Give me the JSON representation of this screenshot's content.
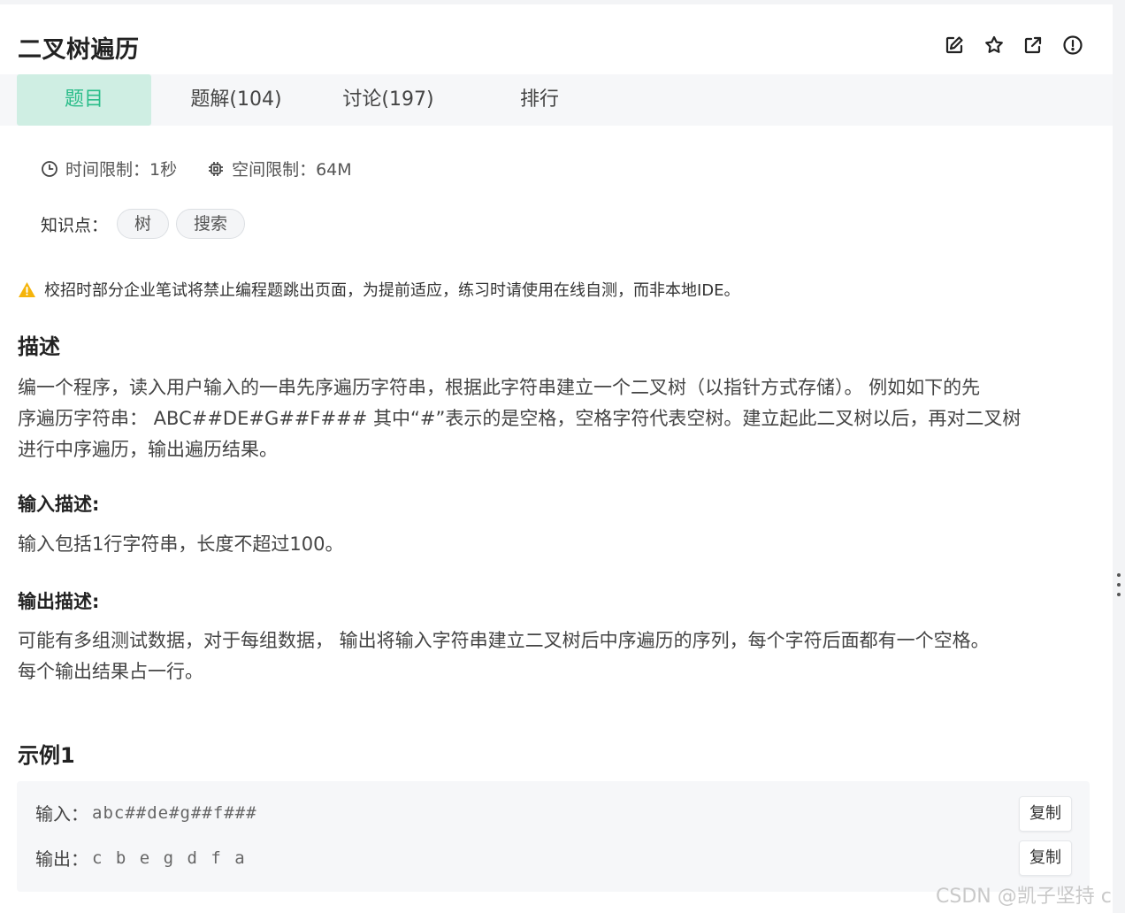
{
  "problem": {
    "title": "二叉树遍历"
  },
  "tabs": [
    {
      "label": "题目"
    },
    {
      "label": "题解(104)"
    },
    {
      "label": "讨论(197)"
    },
    {
      "label": "排行"
    }
  ],
  "limits": {
    "time": "时间限制：1秒",
    "space": "空间限制：64M"
  },
  "knowledge": {
    "label": "知识点：",
    "tags": [
      "树",
      "搜索"
    ]
  },
  "notice": "校招时部分企业笔试将禁止编程题跳出页面，为提前适应，练习时请使用在线自测，而非本地IDE。",
  "description": {
    "heading": "描述",
    "line1": "编一个程序，读入用户输入的一串先序遍历字符串，根据此字符串建立一个二叉树（以指针方式存储）。 例如如下的先",
    "line2": "序遍历字符串： ABC##DE#G##F### 其中“#”表示的是空格，空格字符代表空树。建立起此二叉树以后，再对二叉树",
    "line3": "进行中序遍历，输出遍历结果。"
  },
  "input_desc": {
    "heading": "输入描述:",
    "text": "输入包括1行字符串，长度不超过100。"
  },
  "output_desc": {
    "heading": "输出描述:",
    "line1": "可能有多组测试数据，对于每组数据， 输出将输入字符串建立二叉树后中序遍历的序列，每个字符后面都有一个空格。",
    "line2": "每个输出结果占一行。"
  },
  "example": {
    "heading": "示例1",
    "input_label": "输入：",
    "input_value": "abc##de#g##f###",
    "output_label": "输出：",
    "output_value": "c b e g d f a",
    "copy_label": "复制"
  },
  "watermark": "CSDN @凯子坚持 c",
  "colors": {
    "accent": "#2bbd8a",
    "tab_active_bg": "#cfeee3",
    "warning": "#f5b40a"
  },
  "icons": [
    "edit-icon",
    "star-icon",
    "share-icon",
    "report-icon",
    "clock-icon",
    "chip-icon",
    "warning-icon"
  ]
}
